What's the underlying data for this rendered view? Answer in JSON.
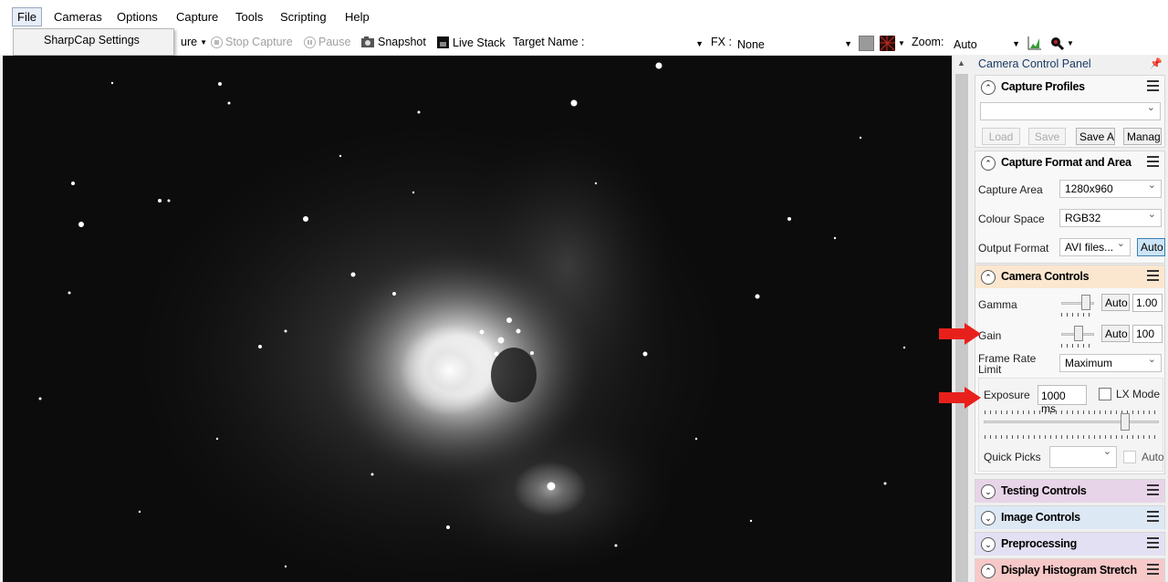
{
  "menu": {
    "file": "File",
    "cameras": "Cameras",
    "options": "Options",
    "capture": "Capture",
    "tools": "Tools",
    "scripting": "Scripting",
    "help": "Help"
  },
  "file_menu": {
    "sharpcap_settings": "SharpCap Settings"
  },
  "toolbar": {
    "start_capture_partial": "ure",
    "stop_capture": "Stop Capture",
    "pause": "Pause",
    "snapshot": "Snapshot",
    "live_stack": "Live Stack",
    "target_name_label": "Target Name :",
    "target_name_value": "",
    "fx_label": "FX :",
    "fx_value": "None",
    "zoom_label": "Zoom:",
    "zoom_value": "Auto"
  },
  "panel": {
    "title": "Camera Control Panel",
    "capture_profiles": {
      "title": "Capture Profiles",
      "profile_value": "",
      "load": "Load",
      "save": "Save",
      "save_as": "Save A",
      "manage": "Manage"
    },
    "capture_format": {
      "title": "Capture Format and Area",
      "capture_area_label": "Capture Area",
      "capture_area_value": "1280x960",
      "colour_space_label": "Colour Space",
      "colour_space_value": "RGB32",
      "output_format_label": "Output Format",
      "output_format_value": "AVI files...",
      "auto": "Auto"
    },
    "camera_controls": {
      "title": "Camera Controls",
      "gamma_label": "Gamma",
      "gamma_auto": "Auto",
      "gamma_value": "1.00",
      "gain_label": "Gain",
      "gain_auto": "Auto",
      "gain_value": "100",
      "frame_rate_label_1": "Frame Rate",
      "frame_rate_label_2": "Limit",
      "frame_rate_value": "Maximum",
      "exposure_label": "Exposure",
      "exposure_value": "1000 ms",
      "lx_mode_label": "LX Mode",
      "quick_picks_label": "Quick Picks",
      "quick_picks_value": "",
      "quick_auto": "Auto"
    },
    "testing_controls": {
      "title": "Testing Controls"
    },
    "image_controls": {
      "title": "Image Controls"
    },
    "preprocessing": {
      "title": "Preprocessing"
    },
    "display_histogram": {
      "title": "Display Histogram Stretch"
    }
  },
  "colors": {
    "arrow": "#e8201c",
    "camera_controls_head": "#fbe7cf",
    "testing_controls_head": "#e8d4e8",
    "image_controls_head": "#dde8f5",
    "preprocessing_head": "#e4e0f3",
    "display_histogram_head": "#f7c8c8"
  },
  "icons": {
    "stop": "stop-circle-icon",
    "pause": "pause-circle-icon",
    "snapshot": "camera-icon",
    "live_stack": "stack-icon",
    "histogram": "histogram-icon",
    "zoom": "magnifier-icon"
  }
}
